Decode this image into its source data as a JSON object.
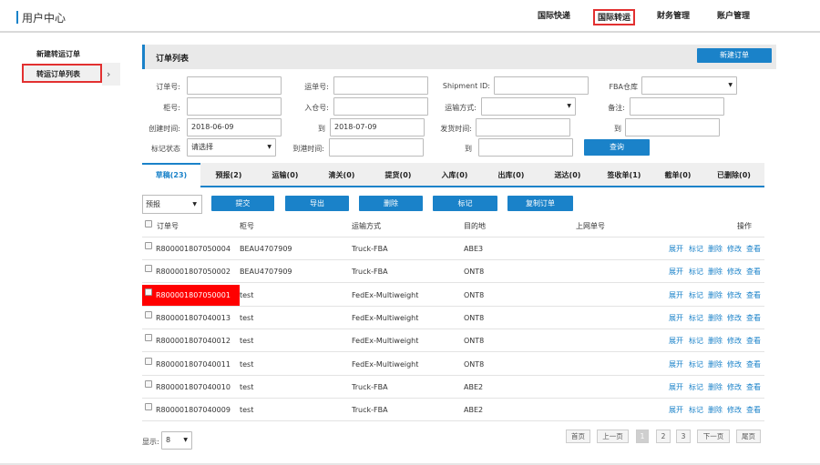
{
  "header": {
    "title": "用户中心",
    "nav": [
      "国际快递",
      "国际转运",
      "财务管理",
      "账户管理"
    ]
  },
  "sidebar": {
    "items": [
      "新建转运订单",
      "转运订单列表"
    ],
    "arrow": "›"
  },
  "panel": {
    "title": "订单列表",
    "new_order_label": "新建订单"
  },
  "filters": {
    "order_no": {
      "label": "订单号:",
      "value": ""
    },
    "waybill_no": {
      "label": "运单号:",
      "value": ""
    },
    "shipment_id": {
      "label": "Shipment ID:",
      "value": ""
    },
    "fba_warehouse": {
      "label": "FBA仓库",
      "value": ""
    },
    "cabinet_no": {
      "label": "柜号:",
      "value": ""
    },
    "inbound_no": {
      "label": "入仓号:",
      "value": ""
    },
    "transport_mode": {
      "label": "运输方式:",
      "value": ""
    },
    "remark": {
      "label": "备注:",
      "value": ""
    },
    "created_from": {
      "label": "创建时间:",
      "value": "2018-06-09"
    },
    "created_to": {
      "label": "到",
      "value": "2018-07-09"
    },
    "ship_from": {
      "label": "发货时间:",
      "value": ""
    },
    "ship_to": {
      "label": "到",
      "value": ""
    },
    "mark_status": {
      "label": "标记状态",
      "value": "请选择"
    },
    "arrive_from": {
      "label": "到港时间:",
      "value": ""
    },
    "arrive_to": {
      "label": "到",
      "value": ""
    },
    "query_label": "查询"
  },
  "tabs": [
    "草稿(23)",
    "预报(2)",
    "运输(0)",
    "清关(0)",
    "提货(0)",
    "入库(0)",
    "出库(0)",
    "送达(0)",
    "签收单(1)",
    "截单(0)",
    "已删除(0)"
  ],
  "actions": {
    "select_value": "预报",
    "buttons": [
      "提交",
      "导出",
      "删除",
      "标记",
      "复制订单"
    ]
  },
  "table": {
    "headers": [
      "订单号",
      "柜号",
      "运输方式",
      "目的地",
      "上网单号",
      "操作"
    ],
    "ops": [
      "展开",
      "标记",
      "删除",
      "修改",
      "查看"
    ],
    "rows": [
      {
        "order": "R800001807050004",
        "cabinet": "BEAU4707909",
        "mode": "Truck-FBA",
        "dest": "ABE3",
        "online": ""
      },
      {
        "order": "R800001807050002",
        "cabinet": "BEAU4707909",
        "mode": "Truck-FBA",
        "dest": "ONT8",
        "online": ""
      },
      {
        "order": "R800001807050001",
        "cabinet": "test",
        "mode": "FedEx-Multiweight",
        "dest": "ONT8",
        "online": ""
      },
      {
        "order": "R800001807040013",
        "cabinet": "test",
        "mode": "FedEx-Multiweight",
        "dest": "ONT8",
        "online": ""
      },
      {
        "order": "R800001807040012",
        "cabinet": "test",
        "mode": "FedEx-Multiweight",
        "dest": "ONT8",
        "online": ""
      },
      {
        "order": "R800001807040011",
        "cabinet": "test",
        "mode": "FedEx-Multiweight",
        "dest": "ONT8",
        "online": ""
      },
      {
        "order": "R800001807040010",
        "cabinet": "test",
        "mode": "Truck-FBA",
        "dest": "ABE2",
        "online": ""
      },
      {
        "order": "R800001807040009",
        "cabinet": "test",
        "mode": "Truck-FBA",
        "dest": "ABE2",
        "online": ""
      }
    ]
  },
  "footer": {
    "show_label": "显示:",
    "page_size": "8",
    "pager": [
      "首页",
      "上一页",
      "1",
      "2",
      "3",
      "下一页",
      "尾页"
    ]
  },
  "colors": {
    "accent": "#1a82c9",
    "highlight": "#ff0000",
    "annotation": "#e23030"
  }
}
